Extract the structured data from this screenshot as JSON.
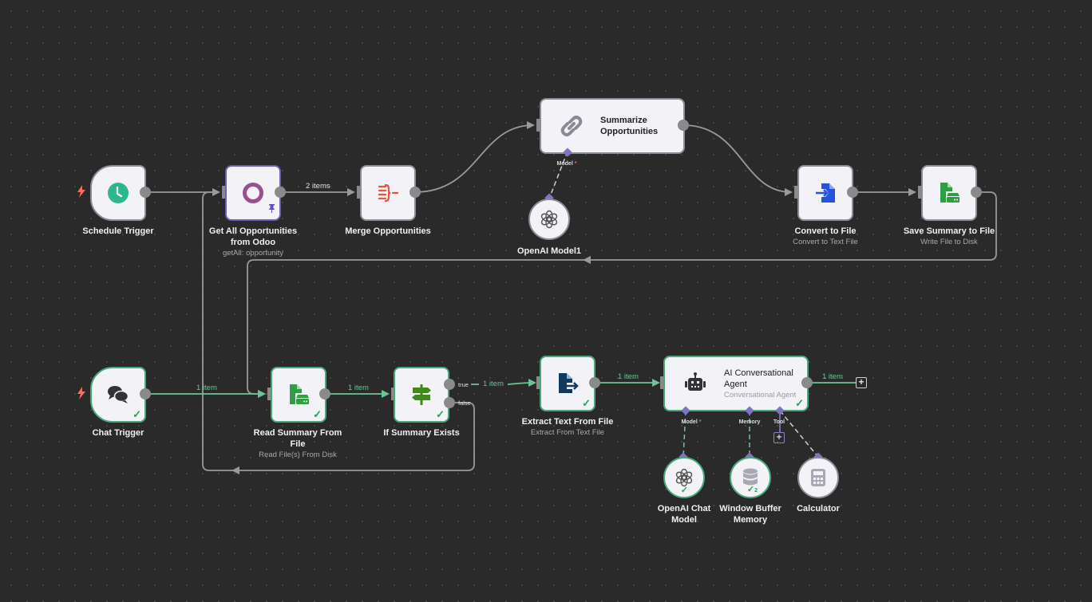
{
  "canvas": {
    "background": "#2a2a2a",
    "grid": "dotted"
  },
  "colors": {
    "success": "#2aa05a",
    "edge_default": "#9a9a9a",
    "edge_success": "#6ec396",
    "ai_port": "#7c76c0",
    "trigger_bolt": "#ff6d5a"
  },
  "nodes": {
    "schedule_trigger": {
      "label": "Schedule Trigger",
      "icon": "clock-icon",
      "trigger": true
    },
    "get_opportunities": {
      "label": "Get All Opportunities from Odoo",
      "subtitle": "getAll: opportunity",
      "icon": "odoo-icon",
      "pinned": true
    },
    "merge_opportunities": {
      "label": "Merge Opportunities",
      "icon": "merge-icon"
    },
    "summarize_opportunities": {
      "label_line1": "Summarize",
      "label_line2": "Opportunities",
      "icon": "chain-link-icon"
    },
    "openai_model1": {
      "label": "OpenAI Model1",
      "icon": "openai-icon"
    },
    "convert_to_file": {
      "label": "Convert to File",
      "subtitle": "Convert to Text File",
      "icon": "file-convert-icon"
    },
    "save_summary": {
      "label": "Save Summary to File",
      "subtitle": "Write File to Disk",
      "icon": "file-disk-icon"
    },
    "chat_trigger": {
      "label": "Chat Trigger",
      "icon": "chat-bubbles-icon",
      "trigger": true,
      "status": "success"
    },
    "read_summary": {
      "label": "Read Summary From File",
      "subtitle": "Read File(s) From Disk",
      "icon": "file-disk-icon",
      "status": "success"
    },
    "if_summary_exists": {
      "label": "If Summary Exists",
      "icon": "signpost-icon",
      "status": "success",
      "outputs": [
        "true",
        "false"
      ]
    },
    "extract_text": {
      "label": "Extract Text From File",
      "subtitle": "Extract From Text File",
      "icon": "file-export-icon",
      "status": "success"
    },
    "ai_agent": {
      "label_line1": "AI Conversational",
      "label_line2": "Agent",
      "subtitle": "Conversational Agent",
      "icon": "robot-icon",
      "status": "success",
      "ports": {
        "model": "Model",
        "memory": "Memory",
        "tool": "Tool",
        "required_mark": "*"
      }
    },
    "openai_chat_model": {
      "label": "OpenAI Chat Model",
      "icon": "openai-icon",
      "status": "success"
    },
    "window_buffer_memory": {
      "label": "Window Buffer Memory",
      "icon": "database-icon",
      "status": "success",
      "run_count": "2"
    },
    "calculator": {
      "label": "Calculator",
      "icon": "calculator-icon"
    }
  },
  "edges": {
    "get_to_merge": "2 items",
    "chat_to_read": "1 item",
    "read_to_if": "1 item",
    "if_true_to_extract": "1 item",
    "extract_to_agent": "1 item",
    "agent_output": "1 item",
    "summarize_model_port": "Model",
    "required_mark": "*"
  },
  "icons": {
    "check": "✓",
    "plus": "+",
    "bolt": "ϟ"
  }
}
